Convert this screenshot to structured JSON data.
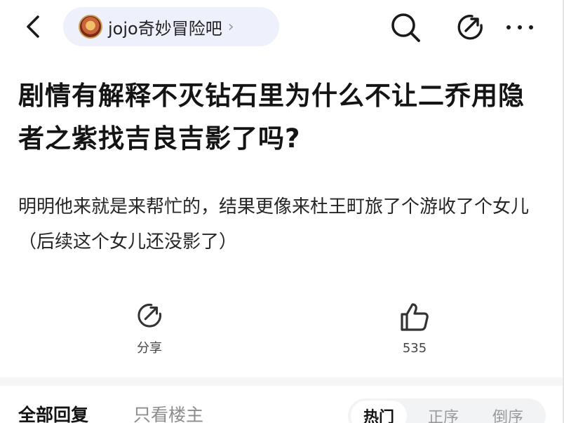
{
  "header": {
    "forum_name": "jojo奇妙冒险吧",
    "chevron": "›",
    "icons": [
      "back-icon",
      "search-icon",
      "share-icon",
      "more-icon"
    ]
  },
  "post": {
    "title": "剧情有解释不灭钻石里为什么不让二乔用隐者之紫找吉良吉影了吗?",
    "body": "明明他来就是来帮忙的，结果更像来杜王町旅了个游收了个女儿（后续这个女儿还没影了）"
  },
  "actions": {
    "share_label": "分享",
    "like_count": "535"
  },
  "replies": {
    "tab_all": "全部回复",
    "tab_owner": "只看楼主",
    "sort_options": [
      "热门",
      "正序",
      "倒序"
    ]
  },
  "colors": {
    "pill_bg": "#eef0fb",
    "text_primary": "#141414",
    "text_muted": "#8c8c8c"
  }
}
